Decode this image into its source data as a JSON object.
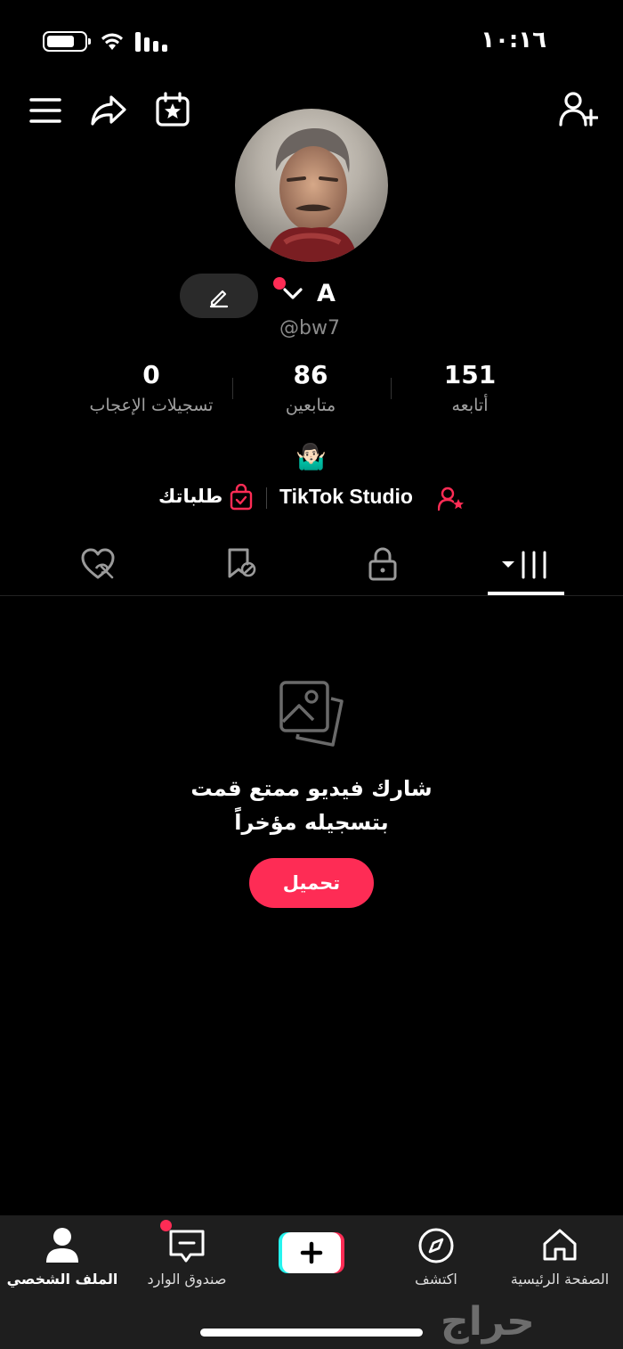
{
  "status_bar": {
    "time": "١٠:١٦"
  },
  "top_bar": {
    "menu_icon": "menu-icon",
    "share_icon": "share-icon",
    "calendar_icon": "calendar-star-icon",
    "add_friend_icon": "add-user-icon"
  },
  "profile": {
    "name": "A",
    "handle": "@bw7",
    "bio_emoji": "🤷🏻‍♂️"
  },
  "stats": [
    {
      "value": "151",
      "label": "أتابعه"
    },
    {
      "value": "86",
      "label": "متابعين"
    },
    {
      "value": "0",
      "label": "تسجيلات الإعجاب"
    }
  ],
  "links": {
    "studio": "TikTok Studio",
    "orders": "طلباتك"
  },
  "tabs": [
    "videos",
    "private",
    "saved",
    "liked"
  ],
  "empty_state": {
    "line1": "شارك فيديو ممتع قمت",
    "line2": "بتسجيله مؤخراً",
    "button": "تحميل"
  },
  "bottom_nav": [
    {
      "id": "home",
      "label": "الصفحة الرئيسية"
    },
    {
      "id": "discover",
      "label": "اكتشف"
    },
    {
      "id": "create",
      "label": ""
    },
    {
      "id": "inbox",
      "label": "صندوق الوارد"
    },
    {
      "id": "profile",
      "label": "الملف الشخصي"
    }
  ],
  "watermark": "حراج",
  "colors": {
    "accent": "#fe2c55",
    "background": "#000000",
    "muted": "#a0a0a0"
  }
}
